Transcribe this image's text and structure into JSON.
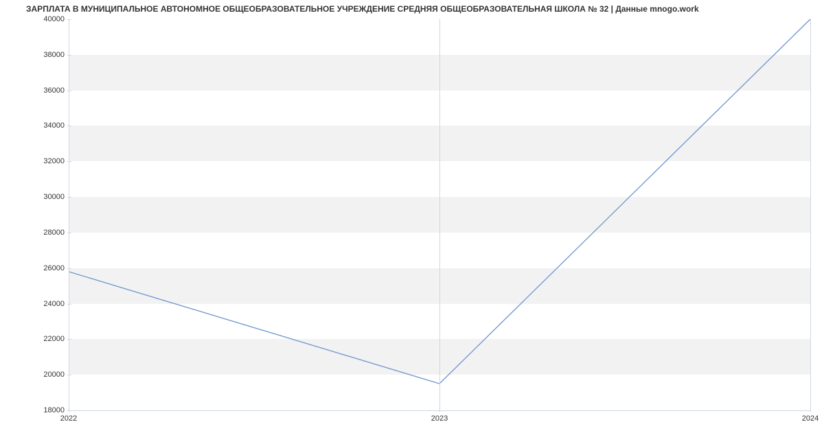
{
  "chart_data": {
    "type": "line",
    "title": "ЗАРПЛАТА В МУНИЦИПАЛЬНОЕ АВТОНОМНОЕ ОБЩЕОБРАЗОВАТЕЛЬНОЕ УЧРЕЖДЕНИЕ СРЕДНЯЯ ОБЩЕОБРАЗОВАТЕЛЬНАЯ ШКОЛА № 32 | Данные mnogo.work",
    "xlabel": "",
    "ylabel": "",
    "x": [
      "2022",
      "2023",
      "2024"
    ],
    "values": [
      25800,
      19500,
      40000
    ],
    "ylim": [
      18000,
      40000
    ],
    "y_ticks": [
      18000,
      20000,
      22000,
      24000,
      26000,
      28000,
      30000,
      32000,
      34000,
      36000,
      38000,
      40000
    ],
    "line_color": "#6d94cf",
    "band_color": "#f2f2f2"
  }
}
